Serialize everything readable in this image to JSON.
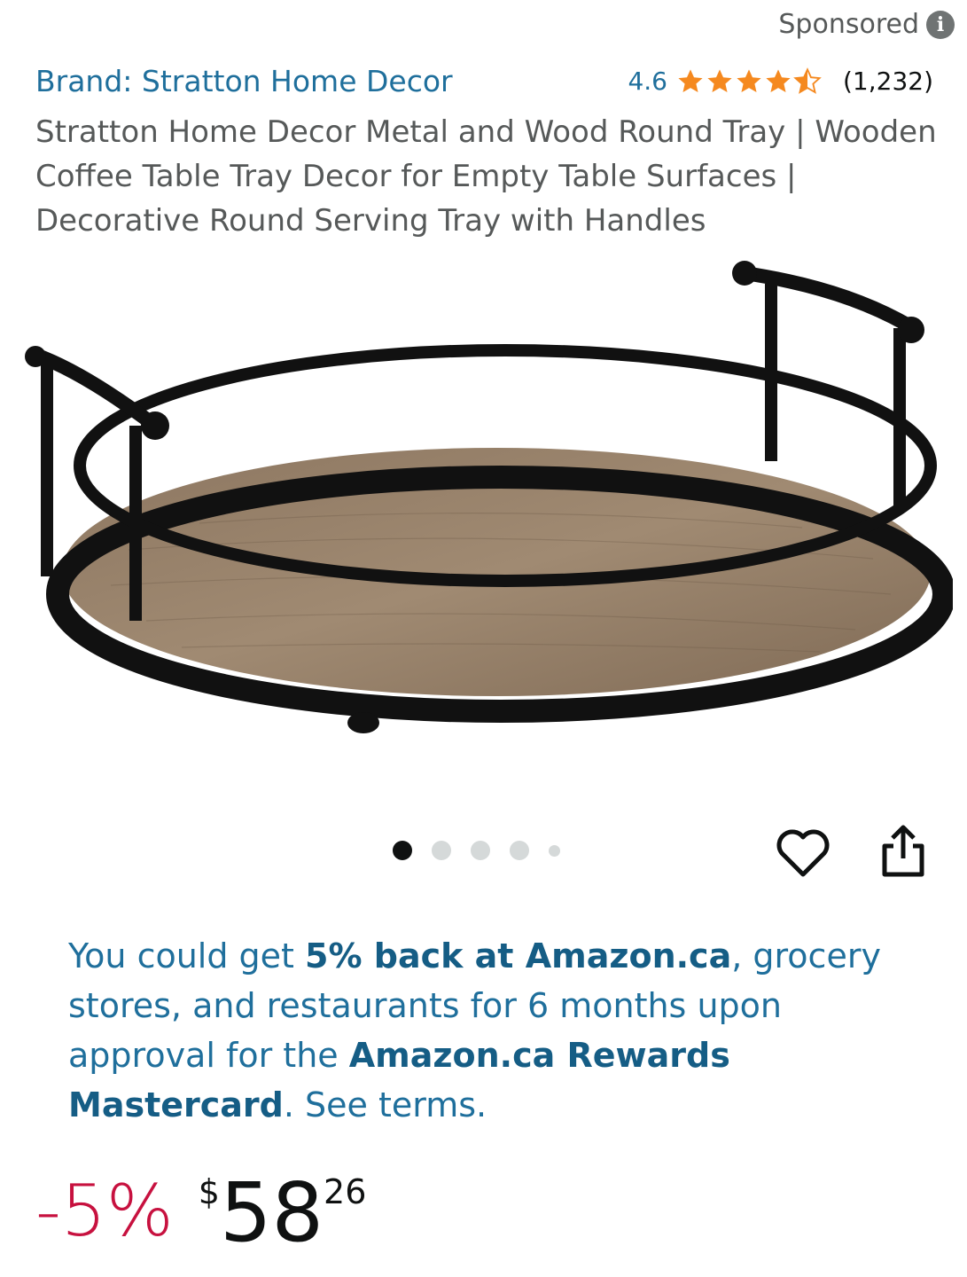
{
  "sponsored": {
    "label": "Sponsored",
    "icon": "info-icon"
  },
  "brand": {
    "label": "Brand: Stratton Home Decor",
    "rating_value": "4.6",
    "stars": 4.5,
    "rating_count": "(1,232)"
  },
  "product": {
    "title": "Stratton Home Decor Metal and Wood Round Tray | Wooden Coffee Table Tray Decor for Empty Table Surfaces | Decorative Round Serving Tray with Handles"
  },
  "carousel": {
    "total_images": 5,
    "active_index": 0
  },
  "actions": {
    "wishlist_icon": "heart-icon",
    "share_icon": "share-icon"
  },
  "promo": {
    "t1": "You could get ",
    "b1": "5% back at Amazon.ca",
    "t2": ", grocery stores, and restaurants for 6 months upon approval for the ",
    "b2": "Amazon.ca Rewards Mastercard",
    "t3": ". ",
    "link": "See terms."
  },
  "price": {
    "discount": "-5%",
    "currency": "$",
    "whole": "58",
    "fraction": "26"
  },
  "colors": {
    "link": "#1f6f9c",
    "star": "#f5891f",
    "discount": "#c7113f",
    "text_secondary": "#565959"
  }
}
